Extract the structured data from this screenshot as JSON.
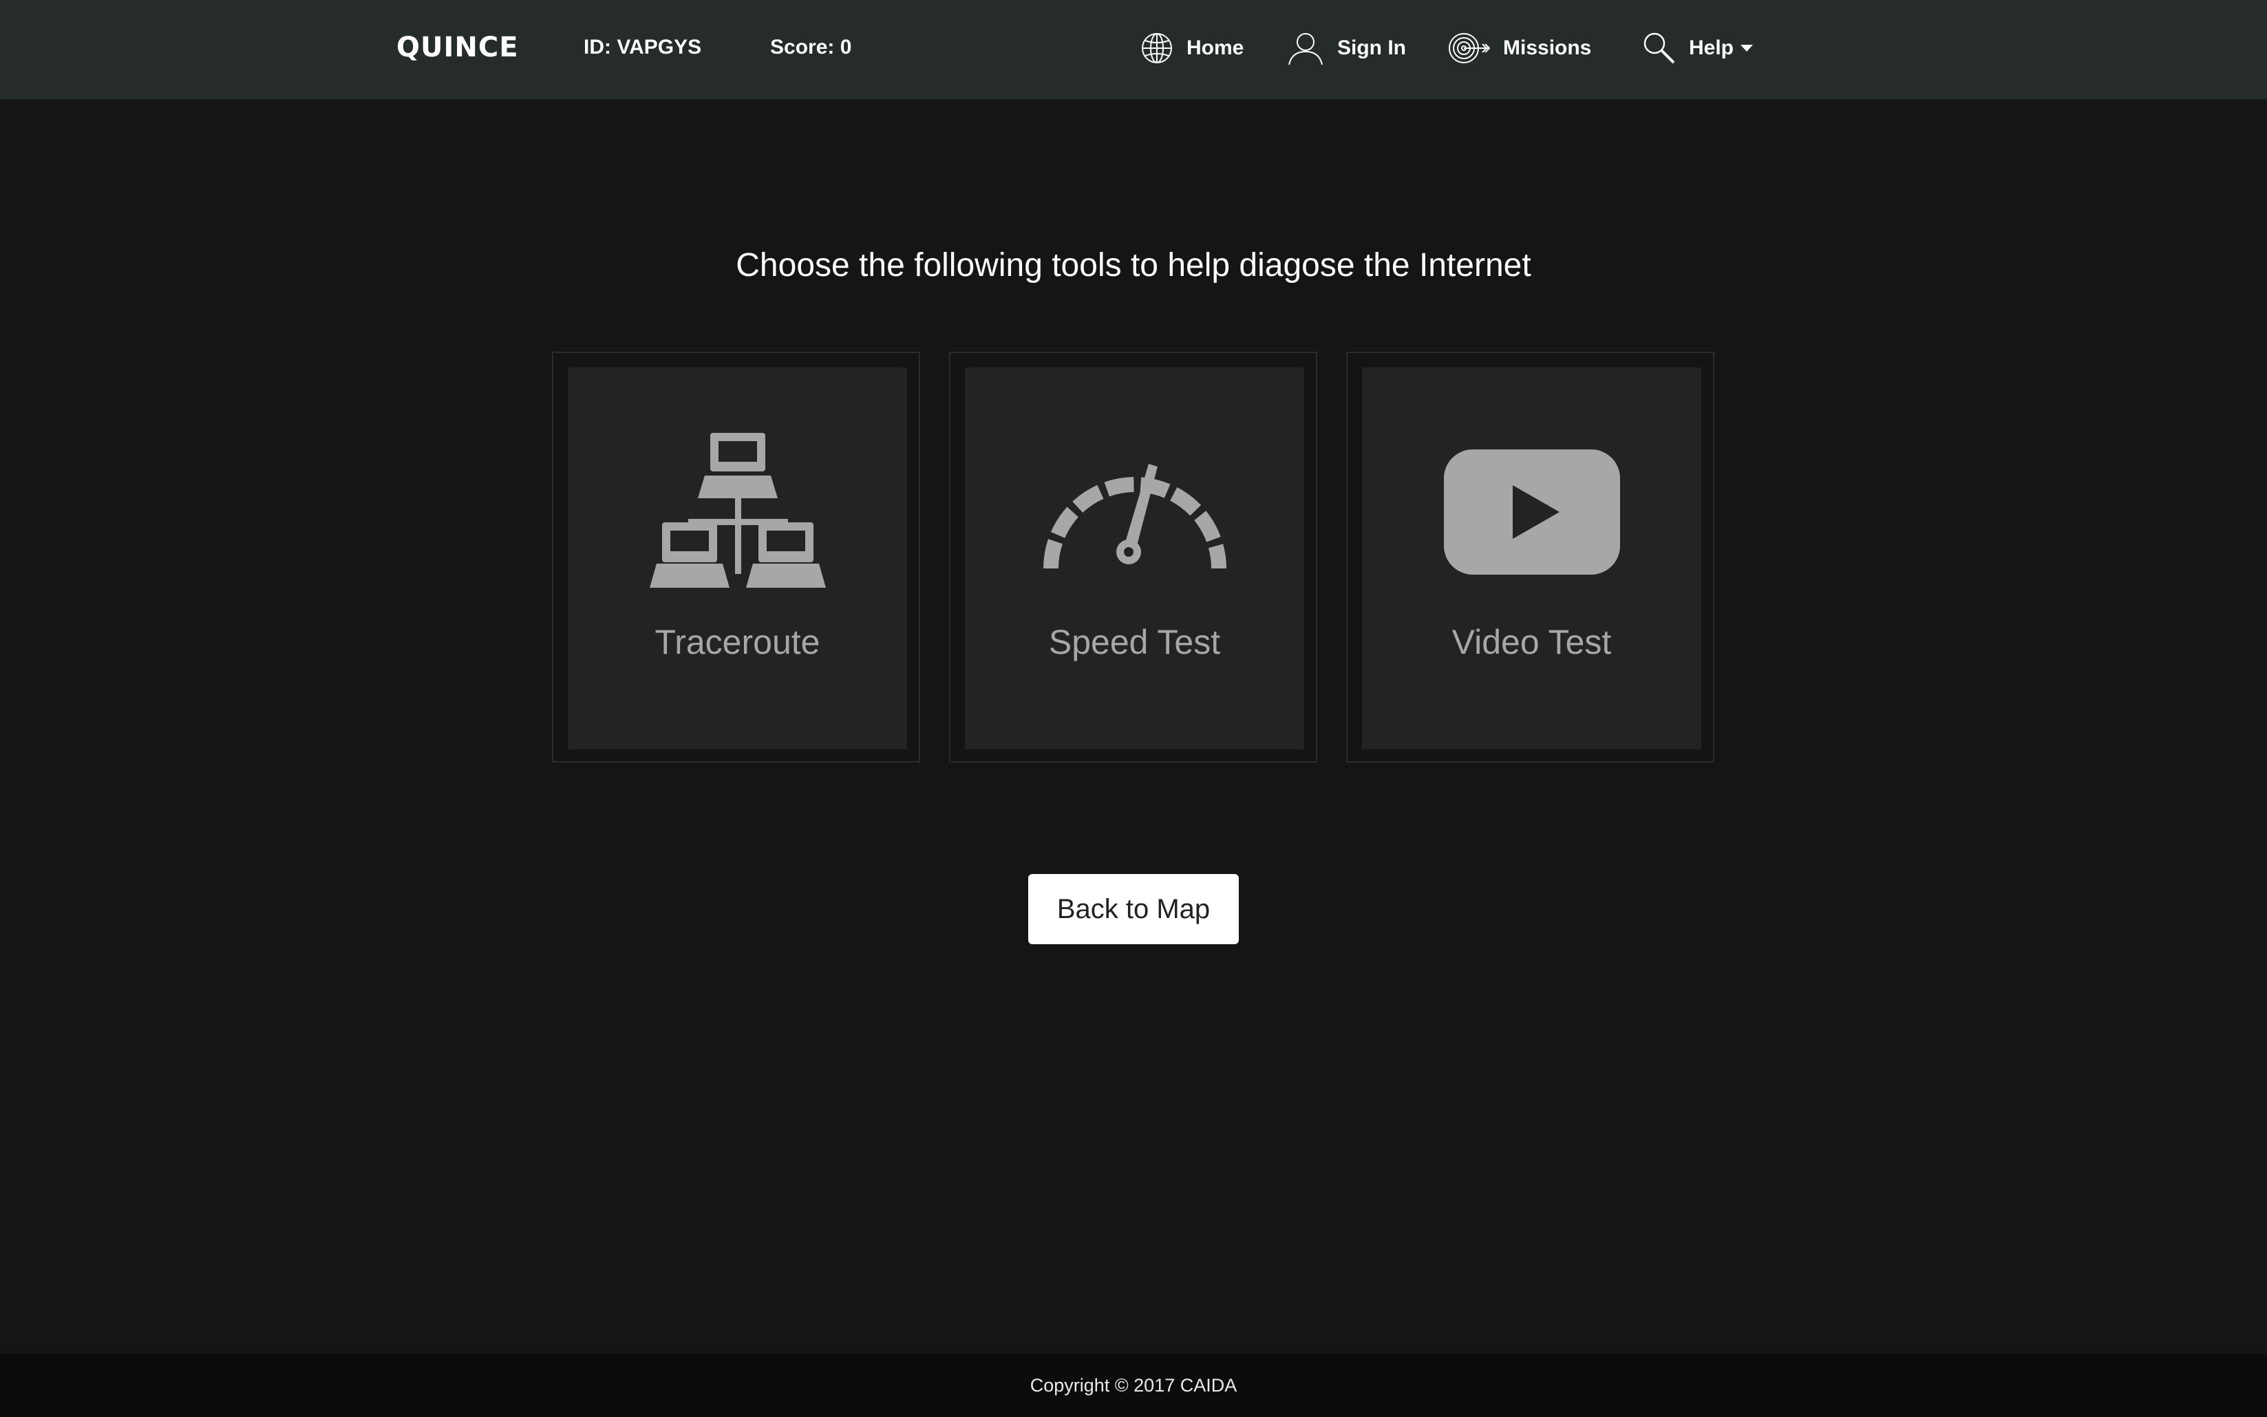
{
  "header": {
    "brand": "QUINCE",
    "id_text": "ID: VAPGYS",
    "score_text": "Score: 0",
    "nav": [
      {
        "label": "Home",
        "icon": "globe-icon"
      },
      {
        "label": "Sign In",
        "icon": "user-icon"
      },
      {
        "label": "Missions",
        "icon": "target-icon"
      },
      {
        "label": "Help",
        "icon": "magnifier-icon"
      }
    ]
  },
  "main": {
    "headline": "Choose the following tools to help diagose the Internet",
    "tools": [
      {
        "label": "Traceroute",
        "icon": "network-icon"
      },
      {
        "label": "Speed Test",
        "icon": "speedometer-icon"
      },
      {
        "label": "Video Test",
        "icon": "video-play-icon"
      }
    ],
    "back_button": "Back to Map"
  },
  "footer": {
    "copyright": "Copyright © 2017 CAIDA"
  },
  "colors": {
    "navbar_bg": "#262b2c",
    "page_bg": "#151515",
    "card_bg": "#232323",
    "icon_gray": "#a7a7a7"
  }
}
